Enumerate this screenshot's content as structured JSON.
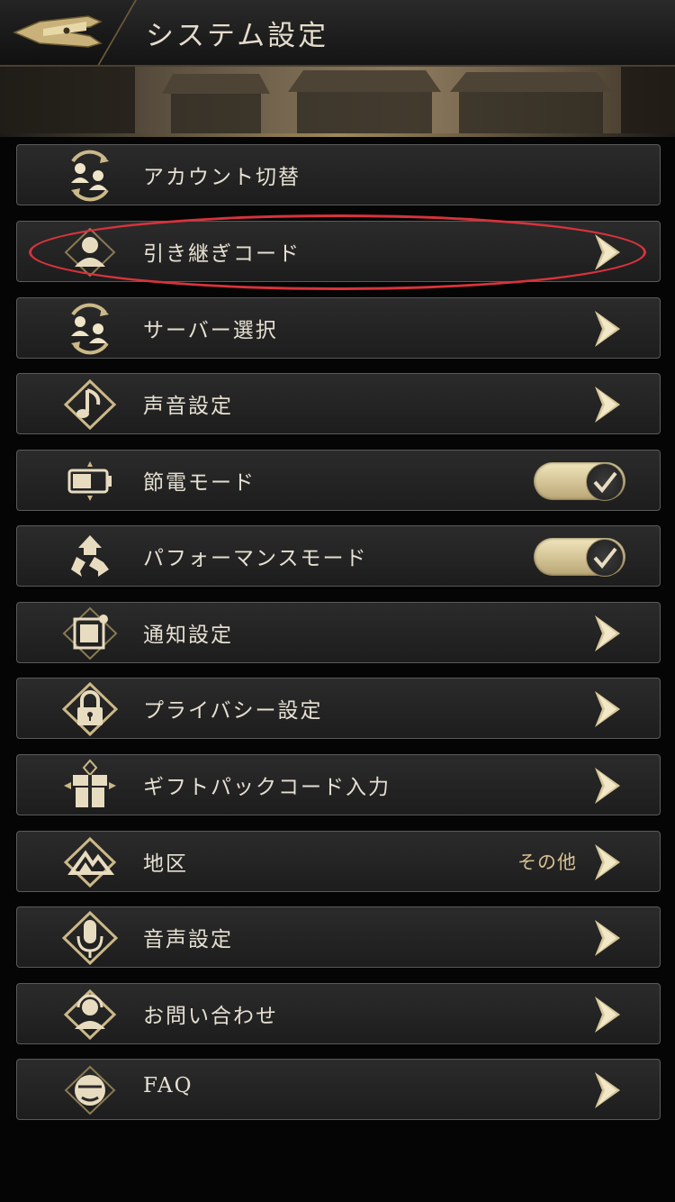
{
  "header": {
    "title": "システム設定"
  },
  "rows": [
    {
      "label": "アカウント切替",
      "icon": "account-switch-icon",
      "control": "none"
    },
    {
      "label": "引き継ぎコード",
      "icon": "user-icon",
      "control": "chevron",
      "highlighted": true
    },
    {
      "label": "サーバー選択",
      "icon": "server-switch-icon",
      "control": "chevron"
    },
    {
      "label": "声音設定",
      "icon": "music-note-icon",
      "control": "chevron"
    },
    {
      "label": "節電モード",
      "icon": "battery-icon",
      "control": "toggle",
      "toggle_on": true
    },
    {
      "label": "パフォーマンスモード",
      "icon": "recycle-icon",
      "control": "toggle",
      "toggle_on": true
    },
    {
      "label": "通知設定",
      "icon": "notification-icon",
      "control": "chevron"
    },
    {
      "label": "プライバシー設定",
      "icon": "lock-icon",
      "control": "chevron"
    },
    {
      "label": "ギフトパックコード入力",
      "icon": "gift-icon",
      "control": "chevron"
    },
    {
      "label": "地区",
      "value": "その他",
      "icon": "mountain-icon",
      "control": "chevron"
    },
    {
      "label": "音声設定",
      "icon": "microphone-icon",
      "control": "chevron"
    },
    {
      "label": "お問い合わせ",
      "icon": "headset-icon",
      "control": "chevron"
    },
    {
      "label": "FAQ",
      "icon": "faq-icon",
      "control": "chevron"
    }
  ],
  "colors": {
    "accent_gold": "#d8c090",
    "highlight_ring": "#d8333c",
    "row_background": "#232323",
    "text": "#e6e0d2"
  }
}
